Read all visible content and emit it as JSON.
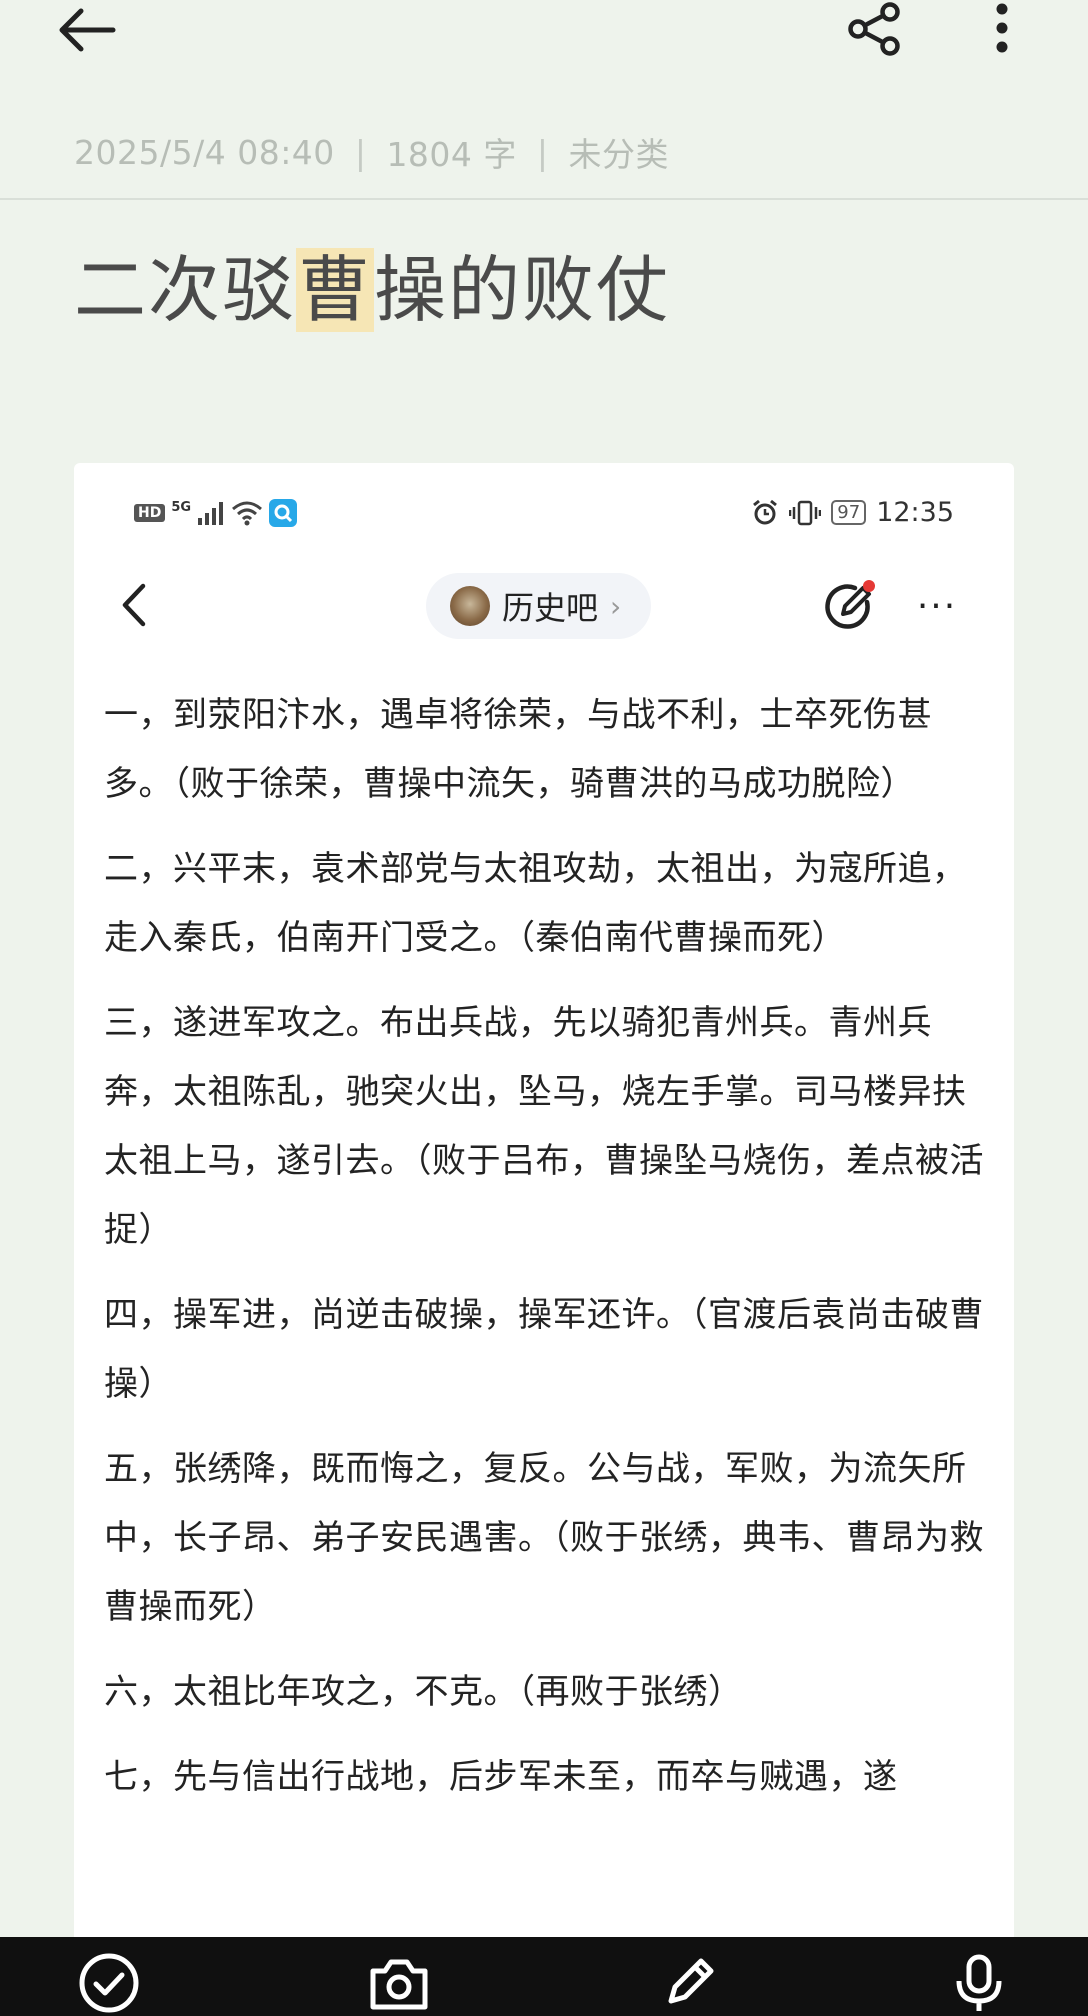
{
  "note": {
    "meta": {
      "datetime": "2025/5/4 08:40",
      "separator": "|",
      "word_count": "1804 字",
      "category": "未分类"
    },
    "title": {
      "before": "二次驳",
      "highlight": "曹",
      "after": "操的败仗"
    }
  },
  "screenshot": {
    "status_bar": {
      "hd": "HD",
      "network": "5G",
      "time": "12:35",
      "battery": "97"
    },
    "nav": {
      "forum_name": "历史吧",
      "forum_chevron": "›",
      "more": "···"
    },
    "paragraphs": [
      "一，到荥阳汴水，遇卓将徐荣，与战不利，士卒死伤甚多。（败于徐荣，曹操中流矢，骑曹洪的马成功脱险）",
      "二，兴平末，袁术部党与太祖攻劫，太祖出，为寇所追，走入秦氏，伯南开门受之。（秦伯南代曹操而死）",
      "三，遂进军攻之。布出兵战，先以骑犯青州兵。青州兵奔，太祖陈乱，驰突火出，坠马，烧左手掌。司马楼异扶太祖上马，遂引去。（败于吕布，曹操坠马烧伤，差点被活捉）",
      "四，操军进，尚逆击破操，操军还许。（官渡后袁尚击破曹操）",
      "五，张绣降，既而悔之，复反。公与战，军败，为流矢所中，长子昂、弟子安民遇害。（败于张绣，典韦、曹昂为救曹操而死）",
      "六，太祖比年攻之，不克。（再败于张绣）",
      "七，先与信出行战地，后步军未至，而卒与贼遇，遂"
    ]
  },
  "colors": {
    "background": "#eef3ec",
    "highlight": "#f6e6b5",
    "meta_text": "#b7bdb6",
    "bottom_bar": "#101010"
  },
  "icons": {
    "back": "arrow-left-icon",
    "share": "share-icon",
    "more": "more-vertical-icon",
    "bottom": [
      "check-circle-icon",
      "camera-icon",
      "pencil-icon",
      "microphone-icon"
    ]
  }
}
